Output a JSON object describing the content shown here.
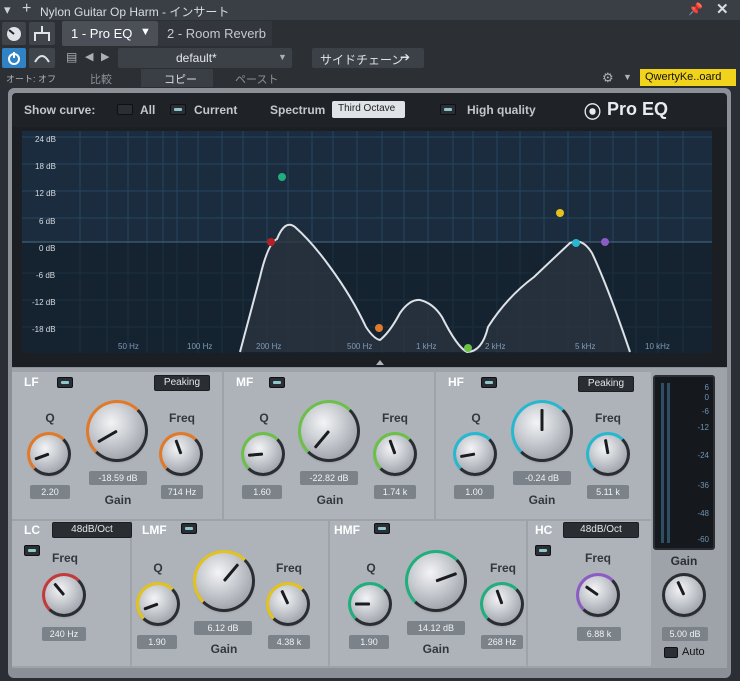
{
  "window": {
    "title": "Nylon Guitar Op Harm - インサート",
    "pin_icon": "pin-icon",
    "close_icon": "close-icon"
  },
  "tabs": [
    {
      "label": "1 - Pro EQ"
    },
    {
      "label": "2 - Room Reverb"
    }
  ],
  "preset": {
    "name": "default*",
    "sidechain_label": "サイドチェーン"
  },
  "toolbar": {
    "auto_label": "オート: オフ",
    "compare_label": "比較",
    "copy_label": "コピー",
    "paste_label": "ペースト",
    "keyboard_label": "QwertyKe..oard"
  },
  "eq_header": {
    "show_curve_label": "Show curve:",
    "all_label": "All",
    "current_label": "Current",
    "spectrum_label": "Spectrum",
    "spectrum_value": "Third Octave",
    "high_quality_label": "High quality",
    "brand": "Pro EQ"
  },
  "graph": {
    "y_labels": [
      "24 dB",
      "18 dB",
      "12 dB",
      "6 dB",
      "0 dB",
      "-6 dB",
      "-12 dB",
      "-18 dB"
    ],
    "x_labels": [
      "50 Hz",
      "100 Hz",
      "200 Hz",
      "500 Hz",
      "1 kHz",
      "2 kHz",
      "5 kHz",
      "10 kHz"
    ]
  },
  "bands": {
    "lf": {
      "tag": "LF",
      "type": "Peaking",
      "q_label": "Q",
      "q": "2.20",
      "gain_value": "-18.59 dB",
      "gain_label": "Gain",
      "freq_label": "Freq",
      "freq": "714 Hz",
      "color": "#e07a2a"
    },
    "mf": {
      "tag": "MF",
      "q_label": "Q",
      "q": "1.60",
      "gain_value": "-22.82 dB",
      "gain_label": "Gain",
      "freq_label": "Freq",
      "freq": "1.74 k",
      "color": "#6cc04a"
    },
    "hf": {
      "tag": "HF",
      "type": "Peaking",
      "q_label": "Q",
      "q": "1.00",
      "gain_value": "-0.24 dB",
      "gain_label": "Gain",
      "freq_label": "Freq",
      "freq": "5.11 k",
      "color": "#27b8cf"
    },
    "lc": {
      "tag": "LC",
      "slope": "48dB/Oct",
      "freq_label": "Freq",
      "freq": "240 Hz",
      "color": "#c23a3a"
    },
    "lmf": {
      "tag": "LMF",
      "q_label": "Q",
      "q": "1.90",
      "gain_value": "6.12 dB",
      "gain_label": "Gain",
      "freq_label": "Freq",
      "freq": "4.38 k",
      "color": "#e3c21e"
    },
    "hmf": {
      "tag": "HMF",
      "q_label": "Q",
      "q": "1.90",
      "gain_value": "14.12 dB",
      "gain_label": "Gain",
      "freq_label": "Freq",
      "freq": "268 Hz",
      "color": "#1fae7c"
    },
    "hc": {
      "tag": "HC",
      "slope": "48dB/Oct",
      "freq_label": "Freq",
      "freq": "6.88 k",
      "color": "#8b5cc4"
    }
  },
  "output": {
    "meter_labels": [
      "6",
      "0",
      "-6",
      "-12",
      "-24",
      "-36",
      "-48",
      "-60"
    ],
    "gain_label": "Gain",
    "gain_value": "5.00 dB",
    "auto_label": "Auto"
  }
}
